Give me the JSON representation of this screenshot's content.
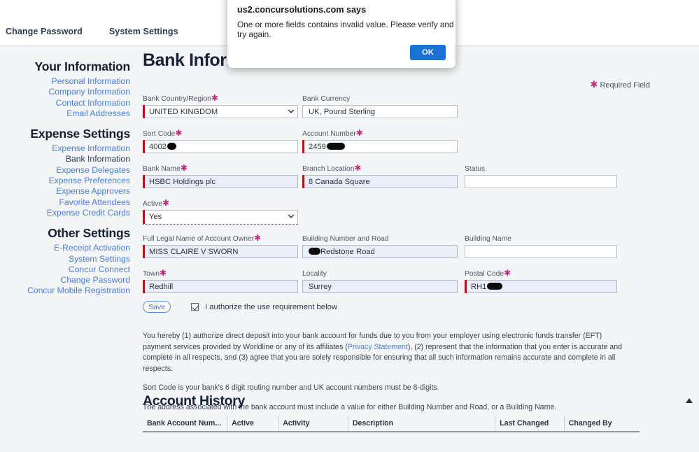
{
  "topnav": {
    "items": [
      {
        "label": "Change Password"
      },
      {
        "label": "System Settings"
      }
    ]
  },
  "dialog": {
    "title": "us2.concursolutions.com says",
    "message": "One or more fields contains invalid value. Please verify and try again.",
    "ok_label": "OK",
    "ok_color": "#1a73d4"
  },
  "sidebar": {
    "groups": [
      {
        "title": "Your Information",
        "items": [
          {
            "label": "Personal Information",
            "current": false
          },
          {
            "label": "Company Information",
            "current": false
          },
          {
            "label": "Contact Information",
            "current": false
          },
          {
            "label": "Email Addresses",
            "current": false
          }
        ]
      },
      {
        "title": "Expense Settings",
        "items": [
          {
            "label": "Expense Information",
            "current": false
          },
          {
            "label": "Bank Information",
            "current": true
          },
          {
            "label": "Expense Delegates",
            "current": false
          },
          {
            "label": "Expense Preferences",
            "current": false
          },
          {
            "label": "Expense Approvers",
            "current": false
          },
          {
            "label": "Favorite Attendees",
            "current": false
          },
          {
            "label": "Expense Credit Cards",
            "current": false
          }
        ]
      },
      {
        "title": "Other Settings",
        "items": [
          {
            "label": "E-Receipt Activation",
            "current": false
          },
          {
            "label": "System Settings",
            "current": false
          },
          {
            "label": "Concur Connect",
            "current": false
          },
          {
            "label": "Change Password",
            "current": false
          },
          {
            "label": "Concur Mobile Registration",
            "current": false
          }
        ]
      }
    ]
  },
  "main": {
    "page_title": "Bank Information",
    "required_note": "Required Field",
    "required_star_color": "#c4267f",
    "form": {
      "bank_country_region": {
        "label": "Bank Country/Region",
        "value": "UNITED KINGDOM",
        "required": true
      },
      "bank_currency": {
        "label": "Bank Currency",
        "value": "UK, Pound Sterling",
        "required": false
      },
      "sort_code": {
        "label": "Sort Code",
        "value": "4002",
        "required": true,
        "redacted": true
      },
      "account_number": {
        "label": "Account Number",
        "value": "2459",
        "required": true,
        "redacted": true
      },
      "bank_name": {
        "label": "Bank Name",
        "value": "HSBC Holdings plc",
        "required": true
      },
      "branch_location": {
        "label": "Branch Location",
        "value": "8 Canada Square",
        "required": true
      },
      "status": {
        "label": "Status",
        "value": "",
        "required": false
      },
      "active": {
        "label": "Active",
        "value": "Yes",
        "required": true
      },
      "full_legal_name": {
        "label": "Full Legal Name of Account Owner",
        "value": "MISS CLAIRE V SWORN",
        "required": true
      },
      "building_number_road": {
        "label": "Building Number and Road",
        "value": "Redstone Road",
        "required": false,
        "redacted_prefix": true
      },
      "building_name": {
        "label": "Building Name",
        "value": "",
        "required": false
      },
      "town": {
        "label": "Town",
        "value": "Redhill",
        "required": true
      },
      "locality": {
        "label": "Locality",
        "value": "Surrey",
        "required": false
      },
      "postal_code": {
        "label": "Postal Code",
        "value": "RH1",
        "required": true,
        "redacted": true
      }
    },
    "save_label": "Save",
    "authorize_label": "I authorize the use requirement below",
    "legal": {
      "para1_before_link": "You hereby (1) authorize direct deposit into your bank account for funds due to you from your employer using electronic funds transfer (EFT) payment services provided by Worldline or any of its affiliates (",
      "privacy_link": "Privacy Statement",
      "para1_after_link": "), (2) represent that the information that you enter is accurate and complete in all respects, and (3) agree that you are solely responsible for ensuring that all such information remains accurate and complete in all respects.",
      "para2": "Sort Code is your bank's 6 digit routing number and UK account numbers must be 8-digits.",
      "para3": "The address associated with the bank account must include a value for either Building Number and Road, or a Building Name."
    },
    "account_history": {
      "title": "Account History",
      "columns": [
        "Bank Account Num...",
        "Active",
        "Activity",
        "Description",
        "Last Changed",
        "Changed By"
      ],
      "rows": []
    }
  }
}
